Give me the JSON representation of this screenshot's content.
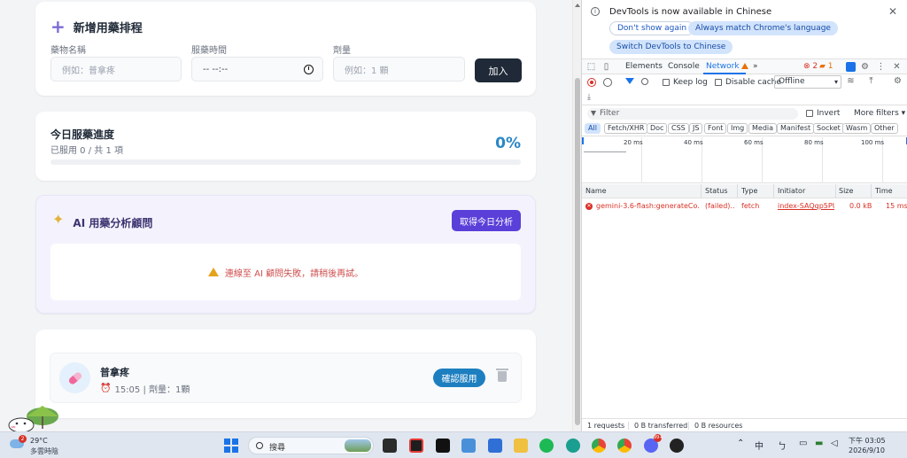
{
  "app": {
    "add_form": {
      "title": "新增用藥排程",
      "name_label": "藥物名稱",
      "name_placeholder": "例如：普拿疼",
      "time_label": "服藥時間",
      "time_value": "-- --:--",
      "dose_label": "劑量",
      "dose_placeholder": "例如：1 顆",
      "add_button": "加入"
    },
    "progress": {
      "title": "今日服藥進度",
      "subtitle": "已服用 0 / 共 1 項",
      "percent_text": "0%",
      "fraction": 0
    },
    "ai": {
      "title": "AI 用藥分析顧問",
      "button": "取得今日分析",
      "error": "連線至 AI 顧問失敗，請稍後再試。"
    },
    "medications": [
      {
        "name": "普拿疼",
        "meta": "15:05 | 劑量：1顆",
        "confirm": "確認服用"
      }
    ]
  },
  "devtools": {
    "banner": {
      "text": "DevTools is now available in Chinese",
      "btn_dont_show": "Don't show again",
      "btn_match": "Always match Chrome's language",
      "btn_switch": "Switch DevTools to Chinese"
    },
    "tabs": [
      "Elements",
      "Console",
      "Network"
    ],
    "active_tab": "Network",
    "errors": "2",
    "warnings": "1",
    "toolbar": {
      "keep_log": "Keep log",
      "disable_cache": "Disable cache",
      "throttle": "Offline"
    },
    "filter": {
      "placeholder": "Filter",
      "invert": "Invert",
      "more": "More filters"
    },
    "types": [
      "All",
      "Fetch/XHR",
      "Doc",
      "CSS",
      "JS",
      "Font",
      "Img",
      "Media",
      "Manifest",
      "Socket",
      "Wasm",
      "Other"
    ],
    "timeline_ticks": [
      "20 ms",
      "40 ms",
      "60 ms",
      "80 ms",
      "100 ms"
    ],
    "columns": [
      "Name",
      "Status",
      "Type",
      "Initiator",
      "Size",
      "Time"
    ],
    "request": {
      "name": "gemini-3.6-flash:generateCo...",
      "status": "(failed)...",
      "type": "fetch",
      "initiator": "index-SAQqp5PU",
      "size": "0.0 kB",
      "time": "15 ms"
    },
    "status_bar": [
      "1 requests",
      "0 B transferred",
      "0 B resources"
    ]
  },
  "taskbar": {
    "temp": "29°C",
    "weather": "多雲時陰",
    "weather_badge": "2",
    "search": "搜尋",
    "ime": "中",
    "time": "下午 03:05",
    "date": "2026/9/10",
    "discord_badge": "99+"
  }
}
